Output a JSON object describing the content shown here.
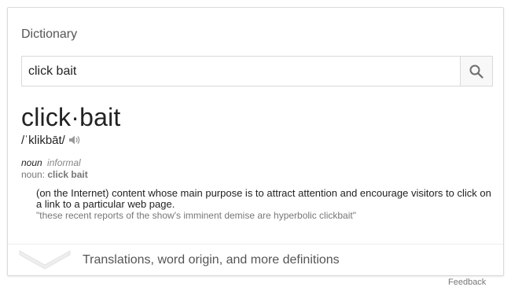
{
  "card": {
    "title": "Dictionary"
  },
  "search": {
    "value": "click bait",
    "button_icon": "search-icon"
  },
  "entry": {
    "headword": "click·bait",
    "pronunciation": "/ˈklikbāt/",
    "speaker_icon": "speaker-icon",
    "part_of_speech": "noun",
    "register": "informal",
    "noun_prefix": "noun: ",
    "noun_form": "click bait",
    "definition": "(on the Internet) content whose main purpose is to attract attention and encourage visitors to click on a link to a particular web page.",
    "example": "\"these recent reports of the show's imminent demise are hyperbolic clickbait\""
  },
  "footer": {
    "more_label": "Translations, word origin, and more definitions",
    "chevron_icon": "chevron-down-icon",
    "feedback_label": "Feedback"
  }
}
